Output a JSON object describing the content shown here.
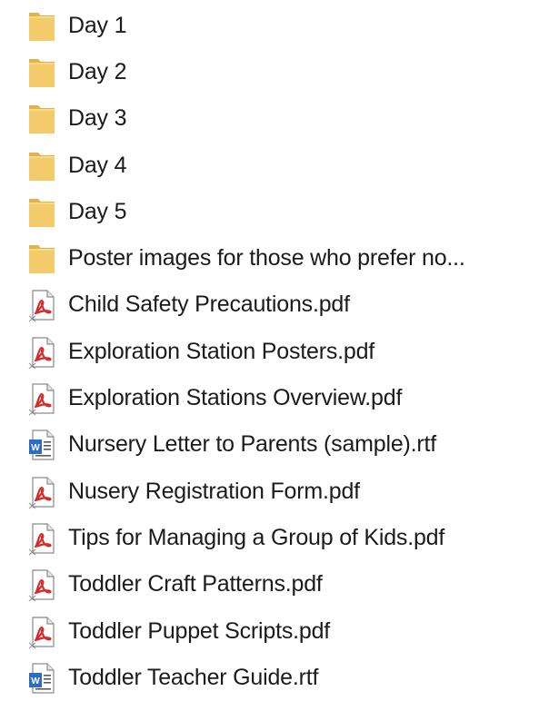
{
  "colors": {
    "folder": "#f4cb6b",
    "folder_back": "#e2b24f",
    "pdf_red": "#d42b2b",
    "rtf_blue": "#2d6cc4"
  },
  "files": [
    {
      "name": "Day 1",
      "icon": "folder-icon"
    },
    {
      "name": "Day 2",
      "icon": "folder-icon"
    },
    {
      "name": "Day 3",
      "icon": "folder-icon"
    },
    {
      "name": "Day 4",
      "icon": "folder-icon"
    },
    {
      "name": "Day 5",
      "icon": "folder-icon"
    },
    {
      "name": "Poster images for those who prefer no...",
      "icon": "folder-icon"
    },
    {
      "name": "Child Safety Precautions.pdf",
      "icon": "pdf-file-icon"
    },
    {
      "name": "Exploration Station Posters.pdf",
      "icon": "pdf-file-icon"
    },
    {
      "name": "Exploration Stations Overview.pdf",
      "icon": "pdf-file-icon"
    },
    {
      "name": "Nursery Letter to Parents (sample).rtf",
      "icon": "rtf-file-icon"
    },
    {
      "name": "Nusery Registration Form.pdf",
      "icon": "pdf-file-icon"
    },
    {
      "name": "Tips for Managing a Group of Kids.pdf",
      "icon": "pdf-file-icon"
    },
    {
      "name": "Toddler Craft Patterns.pdf",
      "icon": "pdf-file-icon"
    },
    {
      "name": "Toddler Puppet Scripts.pdf",
      "icon": "pdf-file-icon"
    },
    {
      "name": "Toddler Teacher Guide.rtf",
      "icon": "rtf-file-icon"
    }
  ]
}
